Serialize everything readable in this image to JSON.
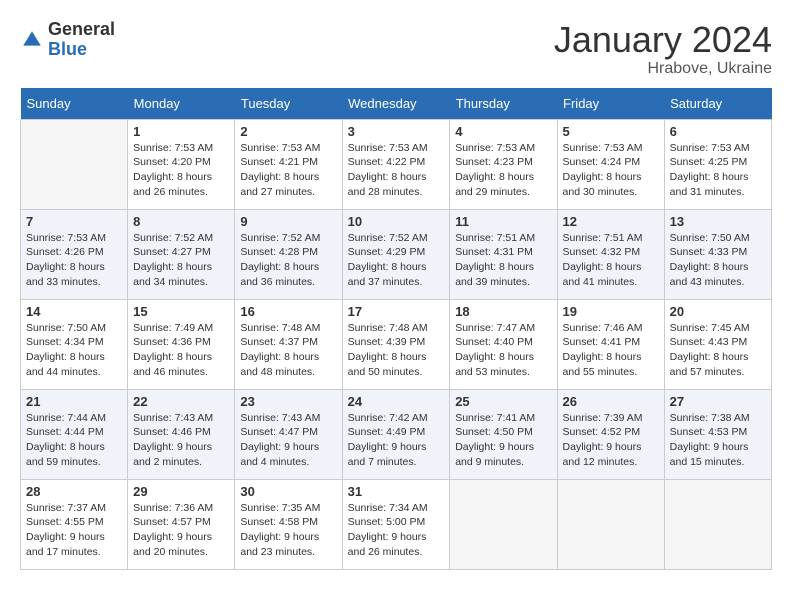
{
  "logo": {
    "general": "General",
    "blue": "Blue"
  },
  "title": {
    "month": "January 2024",
    "location": "Hrabove, Ukraine"
  },
  "calendar": {
    "headers": [
      "Sunday",
      "Monday",
      "Tuesday",
      "Wednesday",
      "Thursday",
      "Friday",
      "Saturday"
    ],
    "weeks": [
      [
        {
          "day": "",
          "info": ""
        },
        {
          "day": "1",
          "info": "Sunrise: 7:53 AM\nSunset: 4:20 PM\nDaylight: 8 hours and 26 minutes."
        },
        {
          "day": "2",
          "info": "Sunrise: 7:53 AM\nSunset: 4:21 PM\nDaylight: 8 hours and 27 minutes."
        },
        {
          "day": "3",
          "info": "Sunrise: 7:53 AM\nSunset: 4:22 PM\nDaylight: 8 hours and 28 minutes."
        },
        {
          "day": "4",
          "info": "Sunrise: 7:53 AM\nSunset: 4:23 PM\nDaylight: 8 hours and 29 minutes."
        },
        {
          "day": "5",
          "info": "Sunrise: 7:53 AM\nSunset: 4:24 PM\nDaylight: 8 hours and 30 minutes."
        },
        {
          "day": "6",
          "info": "Sunrise: 7:53 AM\nSunset: 4:25 PM\nDaylight: 8 hours and 31 minutes."
        }
      ],
      [
        {
          "day": "7",
          "info": "Sunrise: 7:53 AM\nSunset: 4:26 PM\nDaylight: 8 hours and 33 minutes."
        },
        {
          "day": "8",
          "info": "Sunrise: 7:52 AM\nSunset: 4:27 PM\nDaylight: 8 hours and 34 minutes."
        },
        {
          "day": "9",
          "info": "Sunrise: 7:52 AM\nSunset: 4:28 PM\nDaylight: 8 hours and 36 minutes."
        },
        {
          "day": "10",
          "info": "Sunrise: 7:52 AM\nSunset: 4:29 PM\nDaylight: 8 hours and 37 minutes."
        },
        {
          "day": "11",
          "info": "Sunrise: 7:51 AM\nSunset: 4:31 PM\nDaylight: 8 hours and 39 minutes."
        },
        {
          "day": "12",
          "info": "Sunrise: 7:51 AM\nSunset: 4:32 PM\nDaylight: 8 hours and 41 minutes."
        },
        {
          "day": "13",
          "info": "Sunrise: 7:50 AM\nSunset: 4:33 PM\nDaylight: 8 hours and 43 minutes."
        }
      ],
      [
        {
          "day": "14",
          "info": "Sunrise: 7:50 AM\nSunset: 4:34 PM\nDaylight: 8 hours and 44 minutes."
        },
        {
          "day": "15",
          "info": "Sunrise: 7:49 AM\nSunset: 4:36 PM\nDaylight: 8 hours and 46 minutes."
        },
        {
          "day": "16",
          "info": "Sunrise: 7:48 AM\nSunset: 4:37 PM\nDaylight: 8 hours and 48 minutes."
        },
        {
          "day": "17",
          "info": "Sunrise: 7:48 AM\nSunset: 4:39 PM\nDaylight: 8 hours and 50 minutes."
        },
        {
          "day": "18",
          "info": "Sunrise: 7:47 AM\nSunset: 4:40 PM\nDaylight: 8 hours and 53 minutes."
        },
        {
          "day": "19",
          "info": "Sunrise: 7:46 AM\nSunset: 4:41 PM\nDaylight: 8 hours and 55 minutes."
        },
        {
          "day": "20",
          "info": "Sunrise: 7:45 AM\nSunset: 4:43 PM\nDaylight: 8 hours and 57 minutes."
        }
      ],
      [
        {
          "day": "21",
          "info": "Sunrise: 7:44 AM\nSunset: 4:44 PM\nDaylight: 8 hours and 59 minutes."
        },
        {
          "day": "22",
          "info": "Sunrise: 7:43 AM\nSunset: 4:46 PM\nDaylight: 9 hours and 2 minutes."
        },
        {
          "day": "23",
          "info": "Sunrise: 7:43 AM\nSunset: 4:47 PM\nDaylight: 9 hours and 4 minutes."
        },
        {
          "day": "24",
          "info": "Sunrise: 7:42 AM\nSunset: 4:49 PM\nDaylight: 9 hours and 7 minutes."
        },
        {
          "day": "25",
          "info": "Sunrise: 7:41 AM\nSunset: 4:50 PM\nDaylight: 9 hours and 9 minutes."
        },
        {
          "day": "26",
          "info": "Sunrise: 7:39 AM\nSunset: 4:52 PM\nDaylight: 9 hours and 12 minutes."
        },
        {
          "day": "27",
          "info": "Sunrise: 7:38 AM\nSunset: 4:53 PM\nDaylight: 9 hours and 15 minutes."
        }
      ],
      [
        {
          "day": "28",
          "info": "Sunrise: 7:37 AM\nSunset: 4:55 PM\nDaylight: 9 hours and 17 minutes."
        },
        {
          "day": "29",
          "info": "Sunrise: 7:36 AM\nSunset: 4:57 PM\nDaylight: 9 hours and 20 minutes."
        },
        {
          "day": "30",
          "info": "Sunrise: 7:35 AM\nSunset: 4:58 PM\nDaylight: 9 hours and 23 minutes."
        },
        {
          "day": "31",
          "info": "Sunrise: 7:34 AM\nSunset: 5:00 PM\nDaylight: 9 hours and 26 minutes."
        },
        {
          "day": "",
          "info": ""
        },
        {
          "day": "",
          "info": ""
        },
        {
          "day": "",
          "info": ""
        }
      ]
    ]
  }
}
